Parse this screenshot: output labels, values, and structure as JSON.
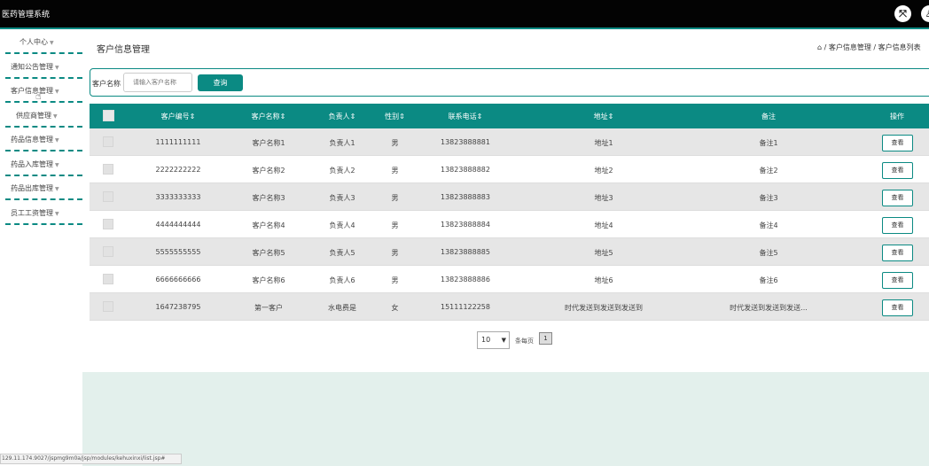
{
  "app": {
    "title": "医药管理系统"
  },
  "header_icons": [
    "fullscreen-icon",
    "user-icon"
  ],
  "sidebar": {
    "items": [
      {
        "label": "个人中心"
      },
      {
        "label": "通知公告管理"
      },
      {
        "label": "客户信息管理"
      },
      {
        "label": "供应商管理"
      },
      {
        "label": "药品信息管理"
      },
      {
        "label": "药品入库管理"
      },
      {
        "label": "药品出库管理"
      },
      {
        "label": "员工工资管理"
      }
    ]
  },
  "page": {
    "title": "客户信息管理",
    "breadcrumb": "⌂ / 客户信息管理 / 客户信息列表"
  },
  "search": {
    "label": "客户名称",
    "placeholder": "请输入客户名称",
    "button": "查询"
  },
  "table": {
    "headers": [
      "客户编号⇕",
      "客户名称⇕",
      "负责人⇕",
      "性别⇕",
      "联系电话⇕",
      "地址⇕",
      "备注",
      "操作"
    ],
    "rows": [
      {
        "id": "1111111111",
        "name": "客户名称1",
        "manager": "负责人1",
        "gender": "男",
        "phone": "13823888881",
        "address": "地址1",
        "remark": "备注1",
        "action": "查看"
      },
      {
        "id": "2222222222",
        "name": "客户名称2",
        "manager": "负责人2",
        "gender": "男",
        "phone": "13823888882",
        "address": "地址2",
        "remark": "备注2",
        "action": "查看"
      },
      {
        "id": "3333333333",
        "name": "客户名称3",
        "manager": "负责人3",
        "gender": "男",
        "phone": "13823888883",
        "address": "地址3",
        "remark": "备注3",
        "action": "查看"
      },
      {
        "id": "4444444444",
        "name": "客户名称4",
        "manager": "负责人4",
        "gender": "男",
        "phone": "13823888884",
        "address": "地址4",
        "remark": "备注4",
        "action": "查看"
      },
      {
        "id": "5555555555",
        "name": "客户名称5",
        "manager": "负责人5",
        "gender": "男",
        "phone": "13823888885",
        "address": "地址5",
        "remark": "备注5",
        "action": "查看"
      },
      {
        "id": "6666666666",
        "name": "客户名称6",
        "manager": "负责人6",
        "gender": "男",
        "phone": "13823888886",
        "address": "地址6",
        "remark": "备注6",
        "action": "查看"
      },
      {
        "id": "1647238795",
        "name": "第一客户",
        "manager": "水电费是",
        "gender": "女",
        "phone": "15111122258",
        "address": "时代发送到发送到发送到",
        "remark": "时代发送到发送到发送...",
        "action": "查看"
      }
    ]
  },
  "pager": {
    "page_size": "10",
    "suffix": "条每页",
    "current_page": "1"
  },
  "statusbar": {
    "text": "129.11.174.9027/jspmg9m0a/jsp/modules/kehuxinxi/list.jsp#"
  },
  "colors": {
    "accent": "#0b8a83",
    "topbar": "#030303",
    "row_alt": "#e6e6e6"
  }
}
